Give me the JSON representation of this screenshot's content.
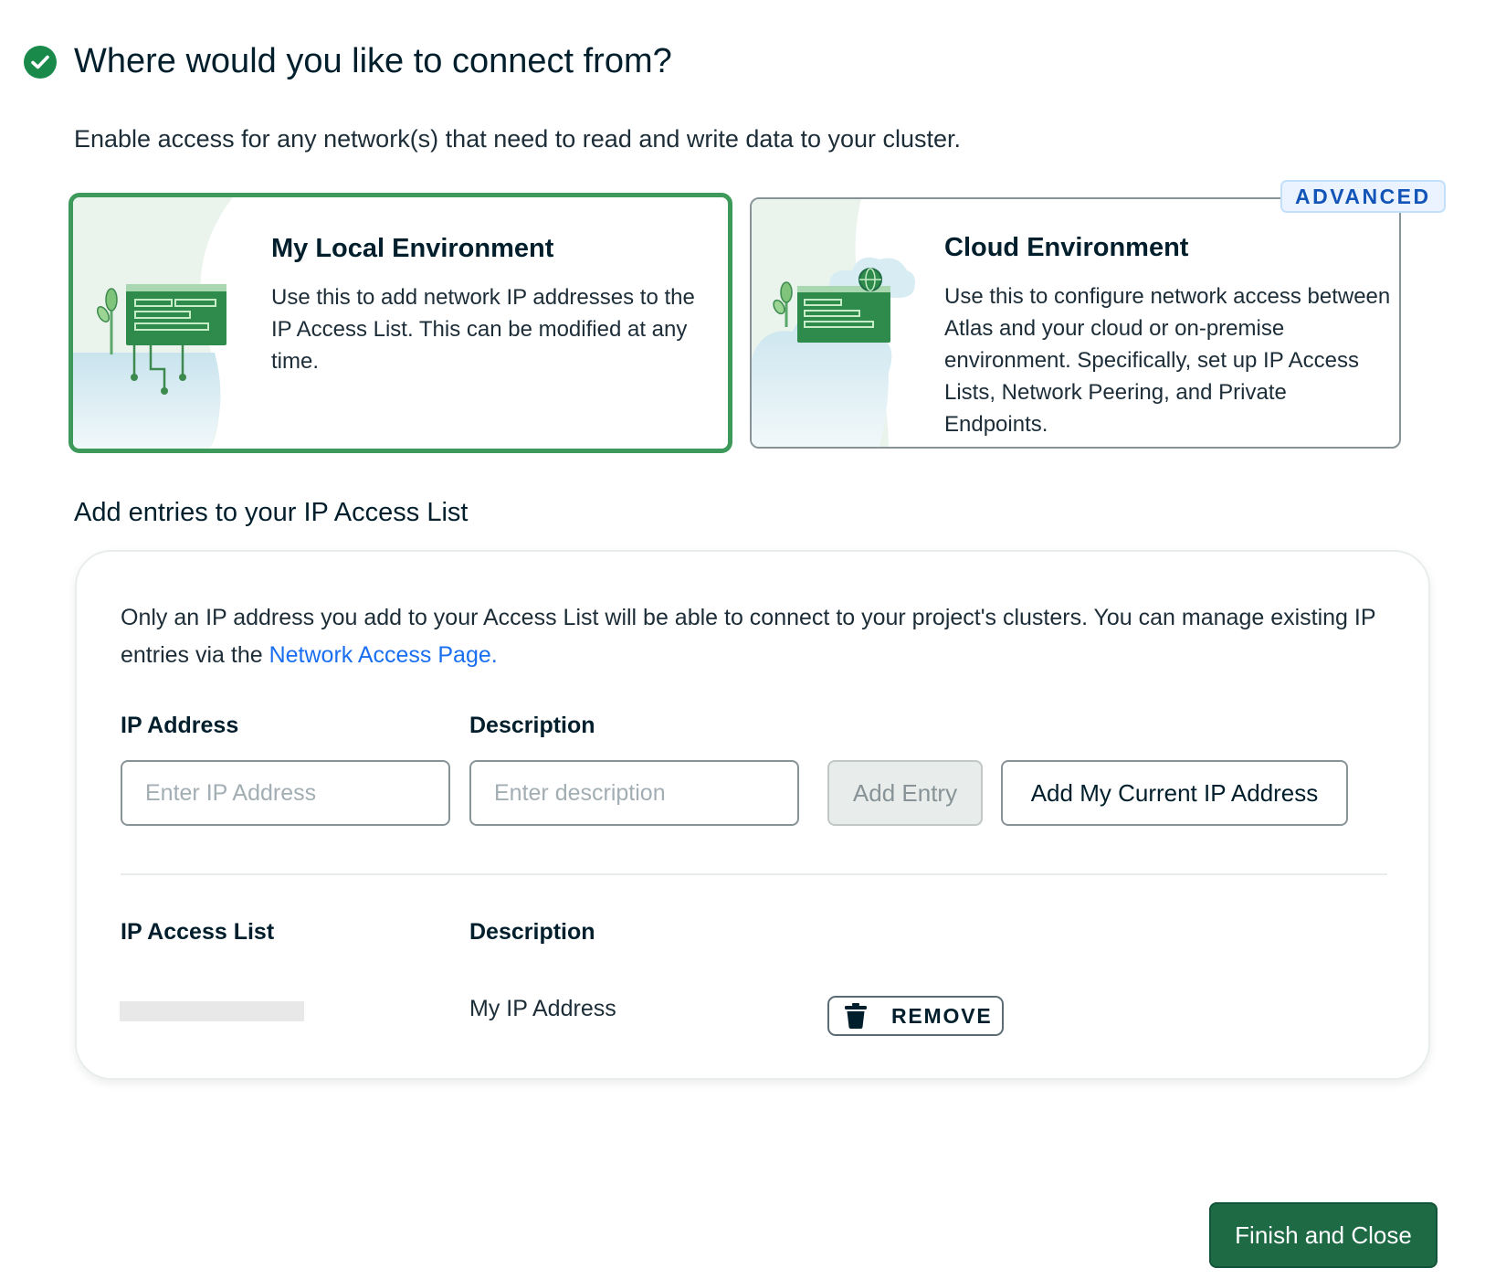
{
  "heading": {
    "title": "Where would you like to connect from?"
  },
  "subtitle": "Enable access for any network(s) that need to read and write data to your cluster.",
  "environments": {
    "local": {
      "title": "My Local Environment",
      "description": "Use this to add network IP addresses to the IP Access List. This can be modified at any time."
    },
    "cloud": {
      "title": "Cloud Environment",
      "badge": "ADVANCED",
      "description": "Use this to configure network access between Atlas and your cloud or on-premise environment. Specifically, set up IP Access Lists, Network Peering, and Private Endpoints."
    }
  },
  "access_list": {
    "section_title": "Add entries to your IP Access List",
    "info_text": "Only an IP address you add to your Access List will be able to connect to your project's clusters. You can manage existing IP entries via the ",
    "info_link": "Network Access Page.",
    "form": {
      "ip_label": "IP Address",
      "ip_placeholder": "Enter IP Address",
      "description_label": "Description",
      "description_placeholder": "Enter description",
      "add_entry_label": "Add Entry",
      "add_current_ip_label": "Add My Current IP Address"
    },
    "table": {
      "headers": [
        "IP Access List",
        "Description"
      ],
      "rows": [
        {
          "description": "My IP Address",
          "remove_label": "REMOVE"
        }
      ]
    }
  },
  "footer": {
    "finish_label": "Finish and Close"
  },
  "colors": {
    "primary_green": "#1d6a45",
    "selected_border": "#3d9a5a",
    "link_blue": "#1a6ff0",
    "badge_blue": "#1254b7"
  },
  "icons": [
    "check-circle-icon",
    "trash-icon"
  ]
}
